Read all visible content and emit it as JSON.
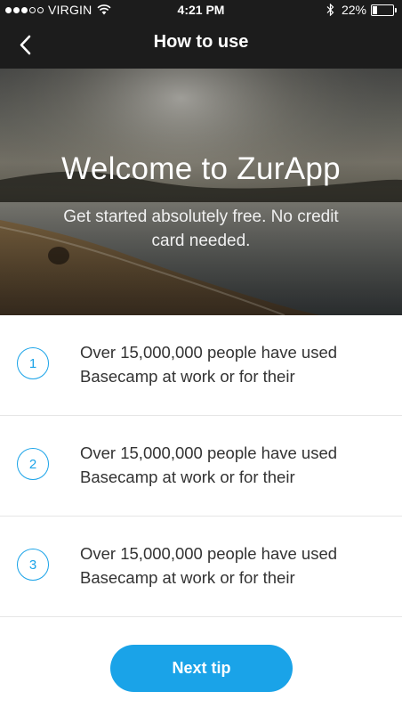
{
  "status_bar": {
    "carrier": "VIRGIN",
    "time": "4:21 PM",
    "battery_percent": "22%",
    "battery_level": 0.22,
    "signal_bars_filled": 3,
    "signal_bars_total": 5,
    "icons": [
      "wifi-icon",
      "bluetooth-icon",
      "battery-icon"
    ]
  },
  "nav": {
    "title": "How to use",
    "back_icon": "chevron-left-icon"
  },
  "hero": {
    "title": "Welcome to ZurApp",
    "subtitle": "Get started absolutely free. No credit card needed."
  },
  "tips": [
    {
      "number": "1",
      "text": "Over 15,000,000 people have used Basecamp at work or for their"
    },
    {
      "number": "2",
      "text": "Over 15,000,000 people have used Basecamp at work or for their"
    },
    {
      "number": "3",
      "text": "Over 15,000,000 people have used Basecamp at work or for their"
    }
  ],
  "next_button": {
    "label": "Next tip"
  },
  "colors": {
    "accent": "#1aa3e8",
    "header_bg": "#1c1c1c",
    "text": "#333333",
    "divider": "#e6e6e6"
  }
}
